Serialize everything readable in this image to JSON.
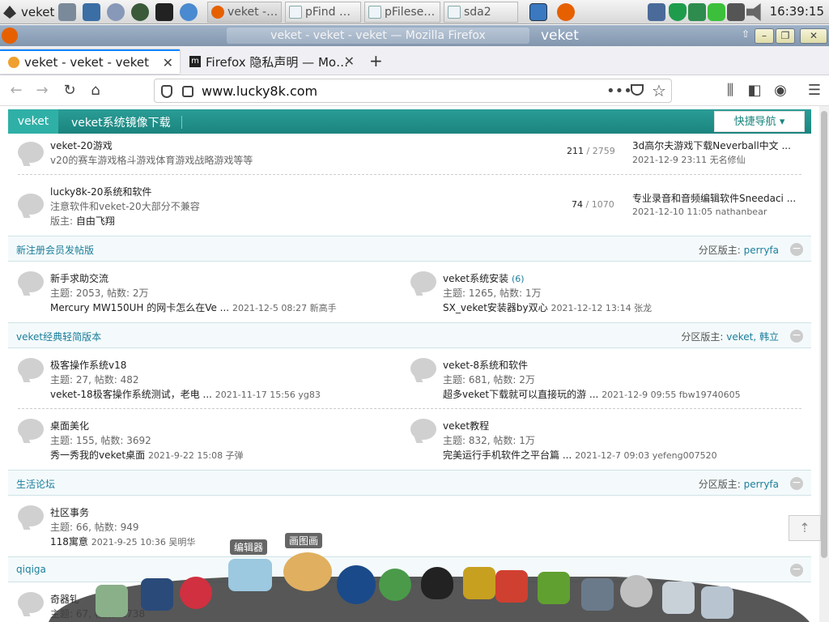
{
  "taskbar": {
    "start_label": "veket",
    "tasks": [
      {
        "label": "veket -…"
      },
      {
        "label": "pFind …"
      },
      {
        "label": "pFilese…"
      },
      {
        "label": "sda2"
      }
    ],
    "clock": "16:39:15"
  },
  "window": {
    "title": "veket - veket - veket — Mozilla Firefox",
    "brand": "veket"
  },
  "tabs": [
    {
      "label": "veket - veket - veket"
    },
    {
      "label": "Firefox 隐私声明 — Mo…"
    }
  ],
  "address": {
    "url": "www.lucky8k.com"
  },
  "sticky": {
    "home": "veket",
    "link": "veket系统镜像下载",
    "quicknav": "快捷导航"
  },
  "top_forums": [
    {
      "name": "veket-20游戏",
      "desc": "v20的赛车游戏格斗游戏体育游戏战略游戏等等",
      "threads": "211",
      "posts": "/ 2759",
      "last_title": "3d高尔夫游戏下载Neverball中文 ...",
      "last_meta": "2021-12-9 23:11 无名修仙"
    },
    {
      "name": "lucky8k-20系统和软件",
      "desc": "注意软件和veket-20大部分不兼容",
      "mod_label": "版主: ",
      "mod": "自由飞翔",
      "threads": "74",
      "posts": "/ 1070",
      "last_title": "专业录音和音频编辑软件Sneedaci ...",
      "last_meta": "2021-12-10 11:05 nathanbear"
    }
  ],
  "sections": [
    {
      "title": "新注册会员发帖版",
      "mod_label": "分区版主: ",
      "mods": "perryfa",
      "forums": [
        {
          "name": "新手求助交流",
          "extra": "",
          "stats": "主题: 2053, 帖数: 2万",
          "last": "Mercury MW150UH 的网卡怎么在Ve ...",
          "last_meta": "2021-12-5 08:27 新高手"
        },
        {
          "name": "veket系统安装",
          "extra": "(6)",
          "stats": "主题: 1265, 帖数: 1万",
          "last": "SX_veket安装器by双心",
          "last_meta": "2021-12-12 13:14 张龙"
        }
      ]
    },
    {
      "title": "veket经典轻简版本",
      "mod_label": "分区版主: ",
      "mods": "veket, 韩立",
      "forums": [
        {
          "name": "极客操作系统v18",
          "extra": "",
          "stats": "主题: 27, 帖数: 482",
          "last": "veket-18极客操作系统测试，老电 ...",
          "last_meta": "2021-11-17 15:56 yg83"
        },
        {
          "name": "veket-8系统和软件",
          "extra": "",
          "stats": "主题: 681, 帖数: 2万",
          "last": "超多veket下载就可以直接玩的游 ...",
          "last_meta": "2021-12-9 09:55 fbw19740605"
        },
        {
          "name": "桌面美化",
          "extra": "",
          "stats": "主题: 155, 帖数: 3692",
          "last": "秀一秀我的veket桌面",
          "last_meta": "2021-9-22 15:08 子弹"
        },
        {
          "name": "veket教程",
          "extra": "",
          "stats": "主题: 832, 帖数: 1万",
          "last": "完美运行手机软件之平台篇 ...",
          "last_meta": "2021-12-7 09:03 yefeng007520"
        }
      ]
    },
    {
      "title": "生活论坛",
      "mod_label": "分区版主: ",
      "mods": "perryfa",
      "forums": [
        {
          "name": "社区事务",
          "extra": "",
          "stats": "主题: 66, 帖数: 949",
          "last": "118寓意",
          "last_meta": "2021-9-25 10:36 吴明华"
        }
      ]
    },
    {
      "title": "qiqiga",
      "forums": [
        {
          "name": "奇器钆",
          "extra": "",
          "stats": "主题: 67, 帖数: 1738",
          "last": "",
          "last_meta": ""
        }
      ]
    }
  ],
  "dock": {
    "tip_editor": "编辑器",
    "tip_paint": "画图画"
  }
}
